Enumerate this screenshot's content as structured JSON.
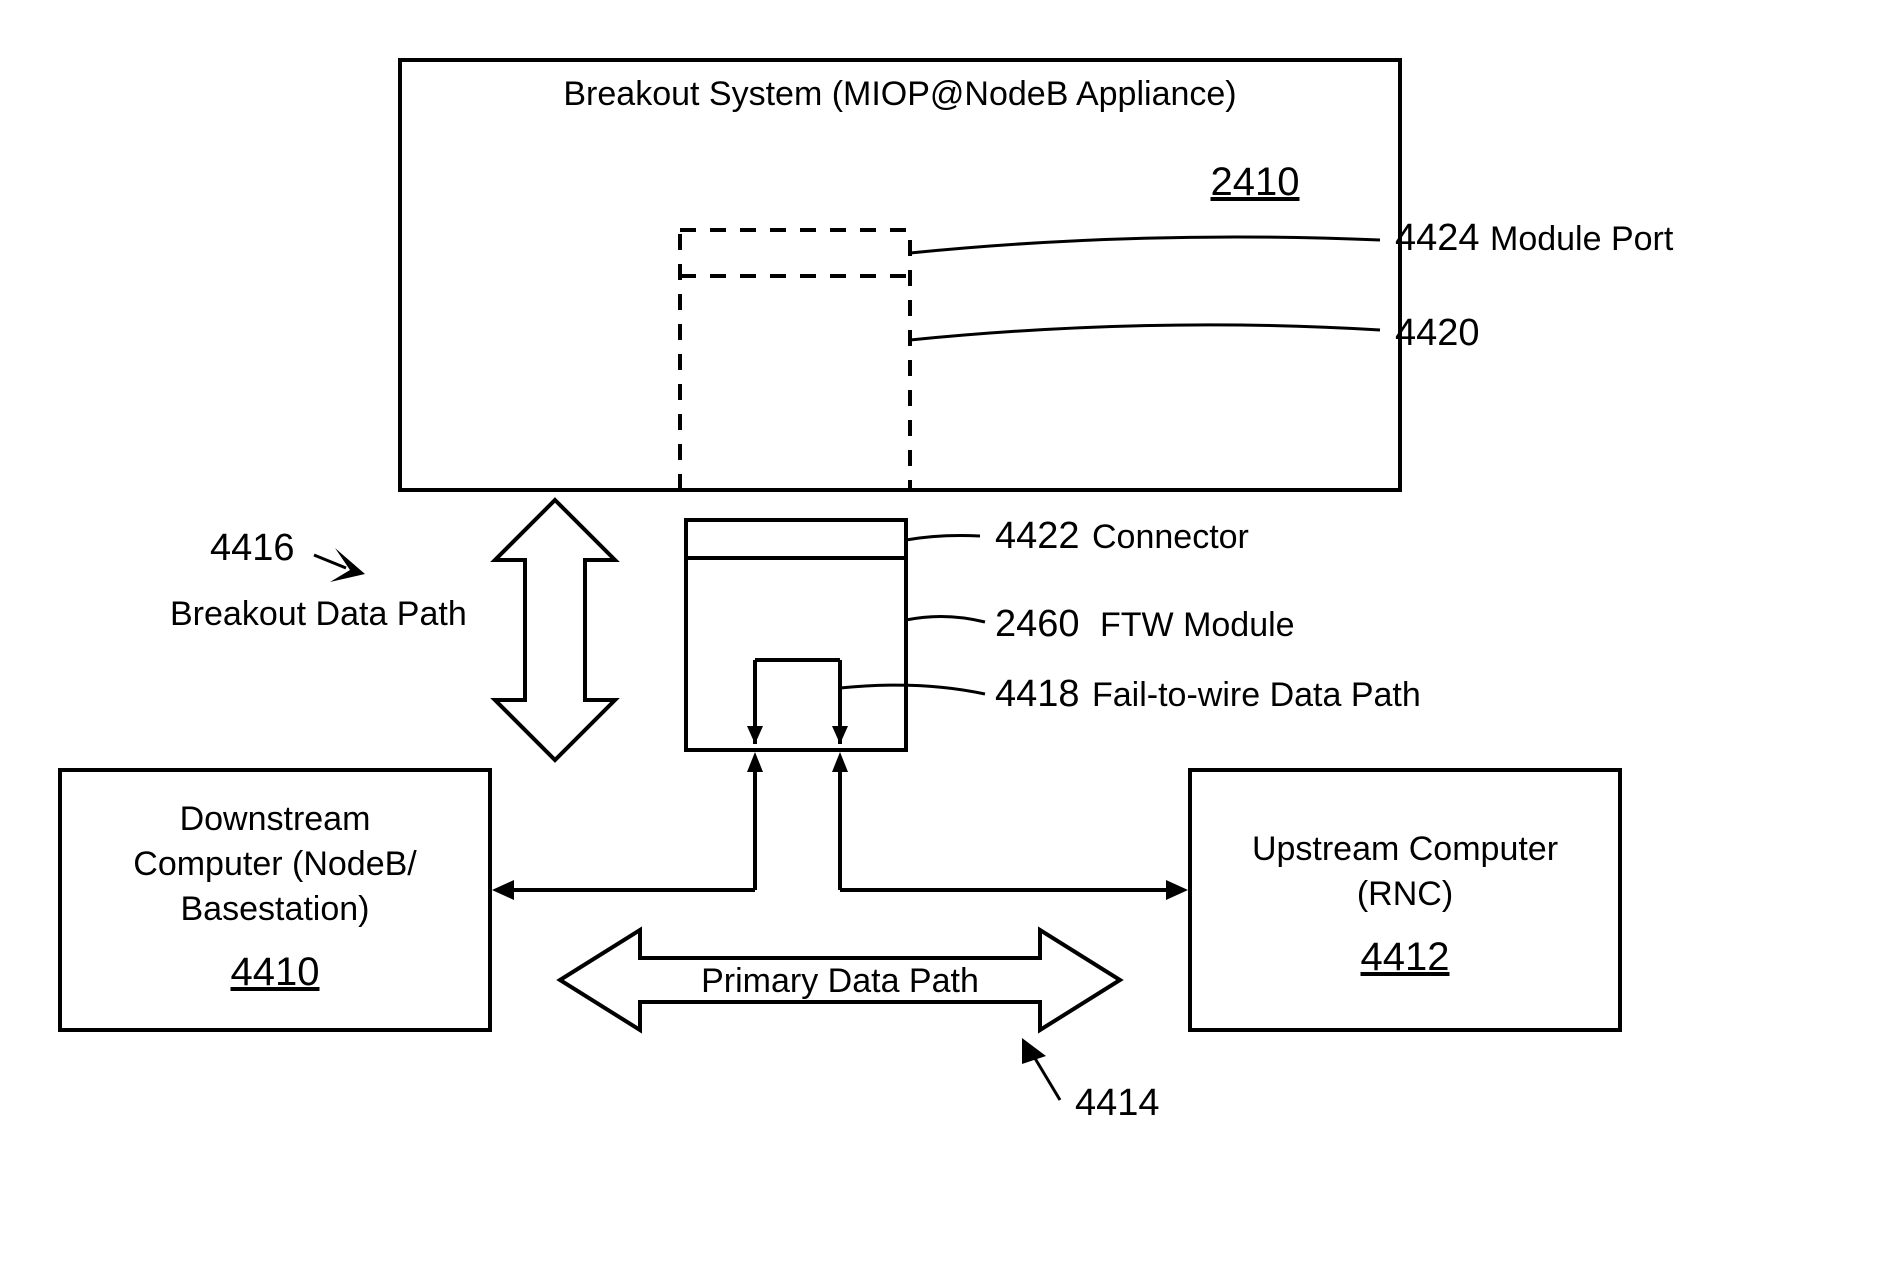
{
  "breakout": {
    "title": "Breakout System (MIOP@NodeB Appliance)",
    "ref": "2410"
  },
  "modulePort": {
    "ref": "4424",
    "label": "Module Port"
  },
  "socket": {
    "ref": "4420"
  },
  "connector": {
    "ref": "4422",
    "label": "Connector"
  },
  "ftwModule": {
    "ref": "2460",
    "label": "FTW Module"
  },
  "ftwPath": {
    "ref": "4418",
    "label": "Fail-to-wire Data Path"
  },
  "breakoutPath": {
    "ref": "4416",
    "label": "Breakout Data Path"
  },
  "downstream": {
    "line1": "Downstream",
    "line2": "Computer (NodeB/",
    "line3": "Basestation)",
    "ref": "4410"
  },
  "upstream": {
    "line1": "Upstream Computer",
    "line2": "(RNC)",
    "ref": "4412"
  },
  "primaryPath": {
    "label": "Primary Data Path",
    "ref": "4414"
  }
}
